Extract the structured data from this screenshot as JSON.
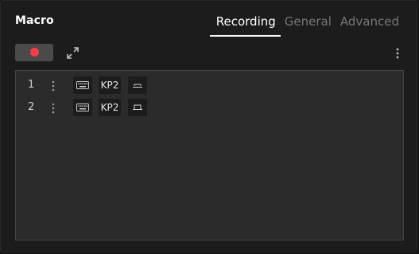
{
  "panel": {
    "title": "Macro"
  },
  "tabs": [
    {
      "label": "Recording",
      "active": true
    },
    {
      "label": "General",
      "active": false
    },
    {
      "label": "Advanced",
      "active": false
    }
  ],
  "toolbar": {
    "record_icon": "record-dot-icon",
    "expand_icon": "expand-icon",
    "more_icon": "vertical-dots-icon",
    "record_color": "#ff3b44"
  },
  "macro_steps": [
    {
      "index": "1",
      "device_icon": "keyboard-icon",
      "key": "KP2",
      "action_icon": "key-press-icon",
      "action": "press"
    },
    {
      "index": "2",
      "device_icon": "keyboard-icon",
      "key": "KP2",
      "action_icon": "key-release-icon",
      "action": "release"
    }
  ],
  "colors": {
    "background": "#121212",
    "panel": "#1c1c1c",
    "list": "#2b2b2b",
    "accent": "#ffffff"
  }
}
